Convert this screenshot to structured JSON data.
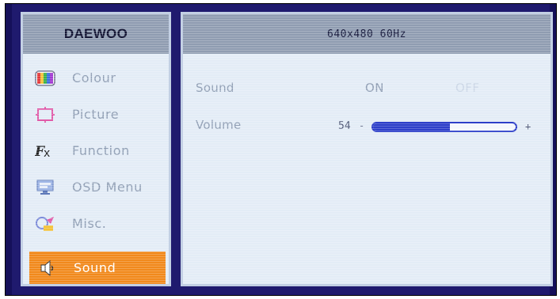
{
  "brand": "DAEWOO",
  "status": "640x480  60Hz",
  "menu": {
    "items": [
      {
        "label": "Colour",
        "icon": "colour-bars-icon"
      },
      {
        "label": "Picture",
        "icon": "picture-frame-icon"
      },
      {
        "label": "Function",
        "icon": "function-fx-icon"
      },
      {
        "label": "OSD  Menu",
        "icon": "osd-menu-icon"
      },
      {
        "label": "Misc.",
        "icon": "misc-icon"
      },
      {
        "label": "Sound",
        "icon": "speaker-icon",
        "selected": true
      }
    ]
  },
  "sound": {
    "label": "Sound",
    "on_label": "ON",
    "off_label": "OFF",
    "selected": "ON"
  },
  "volume": {
    "label": "Volume",
    "value": "54",
    "minus": "-",
    "plus": "+",
    "level_fraction": 0.54
  },
  "colors": {
    "highlight": "#f1891c",
    "slider": "#2d3fc9",
    "frame": "#1f1a6e",
    "panel": "#e3ecf6",
    "header": "#8f9cb1"
  }
}
